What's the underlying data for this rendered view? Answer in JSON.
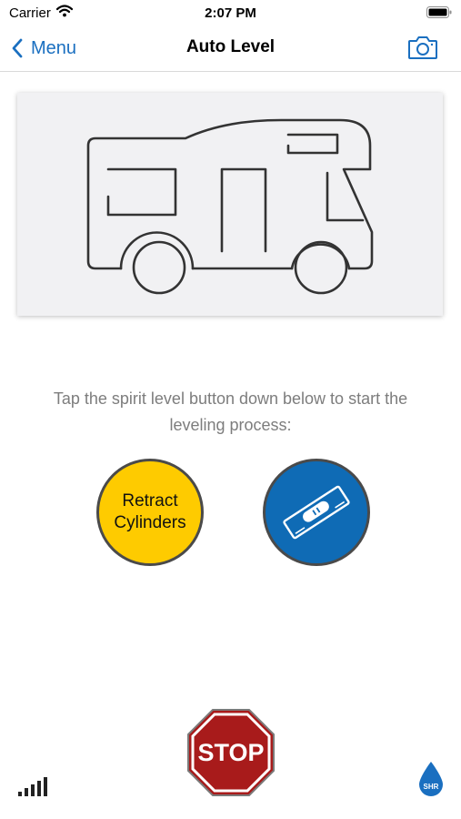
{
  "status_bar": {
    "carrier": "Carrier",
    "time": "2:07 PM"
  },
  "nav": {
    "back_label": "Menu",
    "title": "Auto Level"
  },
  "instruction": "Tap the spirit level button down below to start the leveling process:",
  "buttons": {
    "retract_line1": "Retract",
    "retract_line2": "Cylinders",
    "stop_label": "STOP"
  },
  "logo_text": "SHR",
  "colors": {
    "accent": "#1a6fc0",
    "retract": "#fecb00",
    "level": "#0f6bb5",
    "stop": "#a81b1b",
    "panel": "#f1f1f3"
  },
  "icons": [
    "wifi-icon",
    "battery-icon",
    "chevron-left-icon",
    "camera-icon",
    "rv-illustration",
    "spirit-level-icon",
    "signal-icon",
    "water-drop-icon"
  ]
}
